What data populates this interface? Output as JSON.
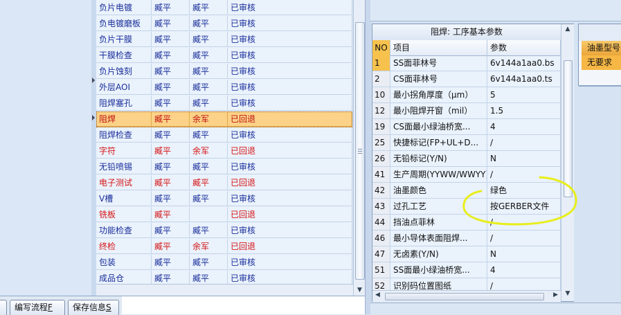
{
  "process_list": {
    "rows": [
      {
        "name": "负片电镀",
        "c1": "臧平",
        "c2": "臧平",
        "status": "已审核",
        "red": false
      },
      {
        "name": "负电镀磨板",
        "c1": "臧平",
        "c2": "臧平",
        "status": "已审核",
        "red": false
      },
      {
        "name": "负片干膜",
        "c1": "臧平",
        "c2": "臧平",
        "status": "已审核",
        "red": false
      },
      {
        "name": "干膜检查",
        "c1": "臧平",
        "c2": "臧平",
        "status": "已审核",
        "red": false
      },
      {
        "name": "负片蚀刻",
        "c1": "臧平",
        "c2": "臧平",
        "status": "已审核",
        "red": false
      },
      {
        "name": "外层AOI",
        "c1": "臧平",
        "c2": "臧平",
        "status": "已审核",
        "red": false
      },
      {
        "name": "阻焊塞孔",
        "c1": "臧平",
        "c2": "臧平",
        "status": "已审核",
        "red": false
      },
      {
        "name": "阻焊",
        "c1": "臧平",
        "c2": "余军",
        "status": "已回退",
        "red": true,
        "selected": true
      },
      {
        "name": "阻焊检查",
        "c1": "臧平",
        "c2": "臧平",
        "status": "已审核",
        "red": false
      },
      {
        "name": "字符",
        "c1": "臧平",
        "c2": "余军",
        "status": "已回退",
        "red": true
      },
      {
        "name": "无铅喷锡",
        "c1": "臧平",
        "c2": "臧平",
        "status": "已审核",
        "red": false
      },
      {
        "name": "电子测试",
        "c1": "臧平",
        "c2": "臧平",
        "status": "已回退",
        "red": true
      },
      {
        "name": "V槽",
        "c1": "臧平",
        "c2": "臧平",
        "status": "已审核",
        "red": false
      },
      {
        "name": "铣板",
        "c1": "臧平",
        "c2": "",
        "status": "已回退",
        "red": true
      },
      {
        "name": "功能检查",
        "c1": "臧平",
        "c2": "臧平",
        "status": "已审核",
        "red": false
      },
      {
        "name": "终检",
        "c1": "臧平",
        "c2": "余军",
        "status": "已回退",
        "red": true
      },
      {
        "name": "包装",
        "c1": "臧平",
        "c2": "臧平",
        "status": "已审核",
        "red": false
      },
      {
        "name": "成品仓",
        "c1": "臧平",
        "c2": "臧平",
        "status": "已审核",
        "red": false
      }
    ]
  },
  "param_panel": {
    "title": "阻焊: 工序基本参数",
    "headers": {
      "no": "NO",
      "item": "项目",
      "param": "参数"
    },
    "rows": [
      {
        "no": "1",
        "item": "SS面菲林号",
        "param": "6v144a1aa0.bs",
        "selected": true
      },
      {
        "no": "2",
        "item": "CS面菲林号",
        "param": "6v144a1aa0.ts"
      },
      {
        "no": "10",
        "item": "最小拐角厚度（μm）",
        "param": "5"
      },
      {
        "no": "12",
        "item": "最小阻焊开窗（mil）",
        "param": "1.5"
      },
      {
        "no": "19",
        "item": "CS面最小绿油桥宽...",
        "param": "4"
      },
      {
        "no": "25",
        "item": "快捷标记(FP+UL+D...",
        "param": "/"
      },
      {
        "no": "26",
        "item": "无铅标记(Y/N)",
        "param": "N"
      },
      {
        "no": "41",
        "item": "生产周期(YYWW/WWYY)",
        "param": "/"
      },
      {
        "no": "42",
        "item": "油墨颜色",
        "param": "绿色"
      },
      {
        "no": "43",
        "item": "过孔工艺",
        "param": "按GERBER文件"
      },
      {
        "no": "44",
        "item": "挡油点菲林",
        "param": "/"
      },
      {
        "no": "46",
        "item": "最小导体表面阻焊...",
        "param": "/"
      },
      {
        "no": "47",
        "item": "无卤素(Y/N)",
        "param": "N"
      },
      {
        "no": "51",
        "item": "SS面最小绿油桥宽...",
        "param": "4"
      },
      {
        "no": "52",
        "item": "识别码位置图纸",
        "param": "/"
      }
    ]
  },
  "ink_panel": {
    "header": "油墨型号",
    "value": "无要求"
  },
  "toolbar": {
    "edit_flow_label": "编写流程",
    "edit_flow_key": "F",
    "save_info_label": "保存信息",
    "save_info_key": "S"
  },
  "colors": {
    "normal_text": "#1a2f9a",
    "alert_text": "#d51616",
    "selection": "#fbd287",
    "annotation": "#e8ee1a"
  }
}
